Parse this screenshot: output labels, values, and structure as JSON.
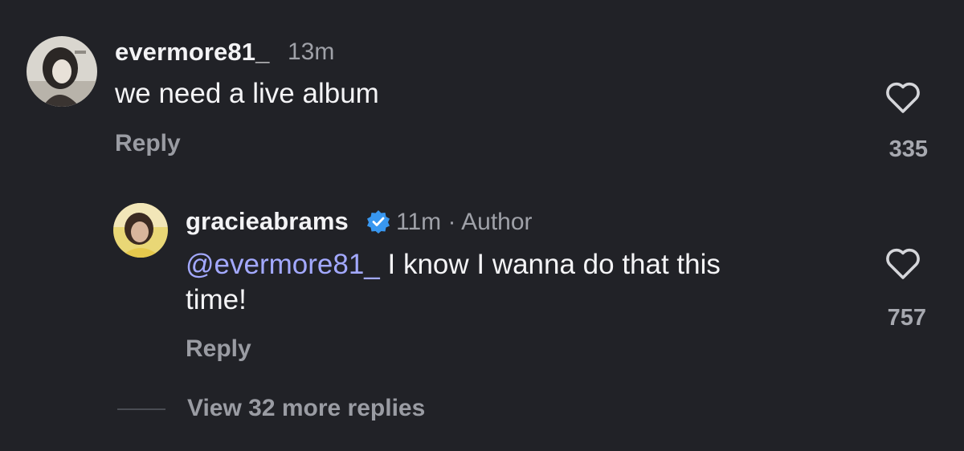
{
  "comment": {
    "username": "evermore81_",
    "time": "13m",
    "text": "we need a live album",
    "reply_label": "Reply",
    "like_count": "335"
  },
  "reply": {
    "username": "gracieabrams",
    "meta": "11m · Author",
    "mention": "@evermore81_",
    "text_line1": " I know I wanna do that this",
    "text_line2": "time!",
    "reply_label": "Reply",
    "like_count": "757"
  },
  "view_more": {
    "label": "View 32 more replies"
  },
  "icons": {
    "like": "heart-outline-icon",
    "verified": "verified-badge-icon"
  },
  "colors": {
    "background": "#212227",
    "mention": "#a3a9ff",
    "verified": "#3897f0",
    "muted": "#9a9ca3"
  }
}
